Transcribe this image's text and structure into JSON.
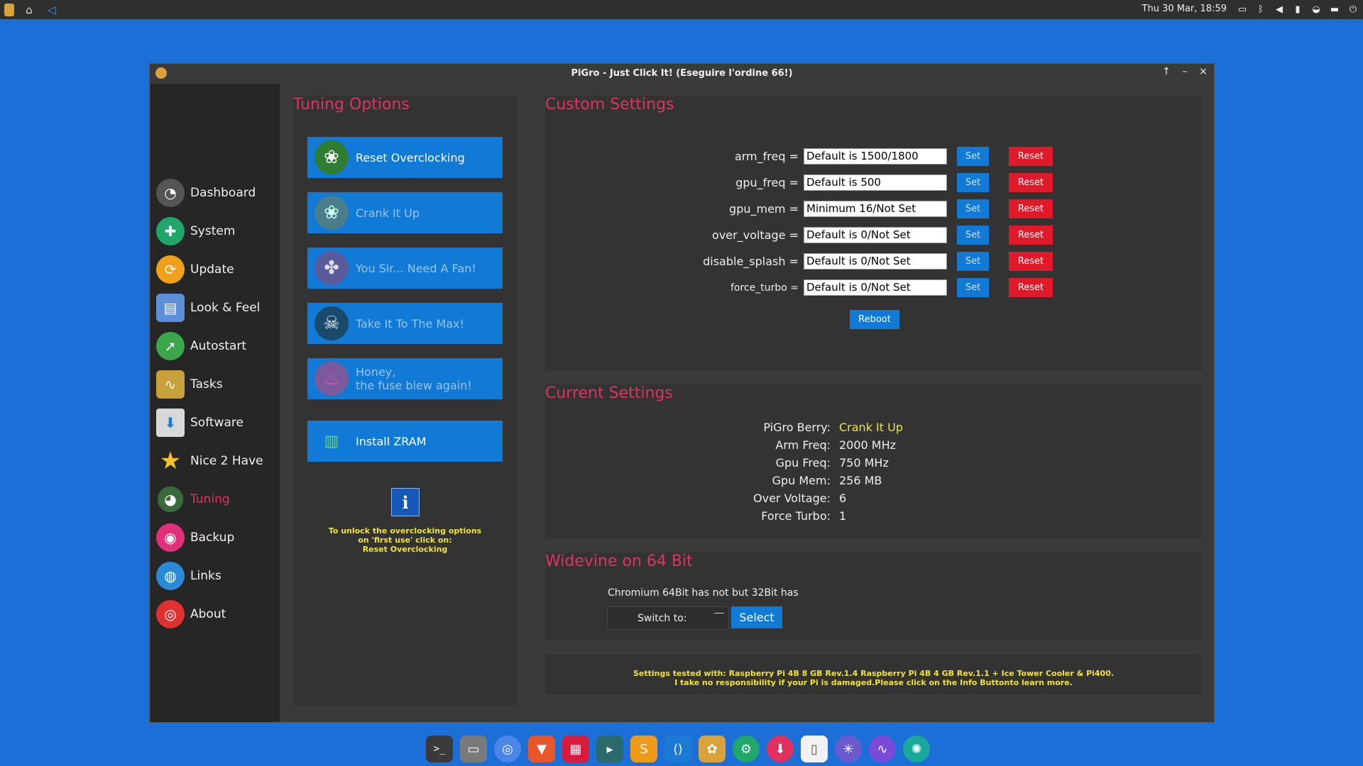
{
  "top_panel": {
    "clock": "Thu 30 Mar, 18:59",
    "left_icons": [
      "app-menu-icon",
      "home-icon",
      "vscode-icon"
    ],
    "tray_icons": [
      "display-icon",
      "bluetooth-icon",
      "volume-icon",
      "battery-icon",
      "notification-icon",
      "trash-icon",
      "power-icon"
    ]
  },
  "window": {
    "title": "PiGro - Just Click It! (Eseguire l'ordine 66!)",
    "controls": [
      "↑",
      "–",
      "×"
    ]
  },
  "sidebar": {
    "items": [
      {
        "label": "Dashboard",
        "icon": "dashboard-gauge-icon",
        "color": "#555555"
      },
      {
        "label": "System",
        "icon": "system-wrench-icon",
        "color": "#1fa86a"
      },
      {
        "label": "Update",
        "icon": "update-icon",
        "color": "#f0a01a"
      },
      {
        "label": "Look & Feel",
        "icon": "palette-icon",
        "color": "#5b8fd9"
      },
      {
        "label": "Autostart",
        "icon": "rocket-icon",
        "color": "#3aa84a"
      },
      {
        "label": "Tasks",
        "icon": "tasks-chart-icon",
        "color": "#c9a13a"
      },
      {
        "label": "Software",
        "icon": "software-box-icon",
        "color": "#d8d8d8"
      },
      {
        "label": "Nice 2 Have",
        "icon": "star-icon",
        "color": "#f6c12a"
      },
      {
        "label": "Tuning",
        "icon": "tuning-gauge-icon",
        "color": "#3b6b3b"
      },
      {
        "label": "Backup",
        "icon": "backup-icon",
        "color": "#e0307a"
      },
      {
        "label": "Links",
        "icon": "globe-icon",
        "color": "#2a8ad8"
      },
      {
        "label": "About",
        "icon": "lifebuoy-icon",
        "color": "#e03030"
      }
    ],
    "active": "Tuning"
  },
  "tuning": {
    "title": "Tuning Options",
    "buttons": [
      {
        "label": "Reset Overclocking",
        "icon": "raspberry-turtle-icon"
      },
      {
        "label": "Crank It Up",
        "icon": "raspberry-turtle-icon"
      },
      {
        "label": "You Sir... Need A Fan!",
        "icon": "raspberry-fan-icon"
      },
      {
        "label": "Take It To The Max!",
        "icon": "skull-icon"
      },
      {
        "label_line1": "Honey,",
        "label_line2": "the fuse blew again!",
        "icon": "fire-icon"
      },
      {
        "label": "Install ZRAM",
        "icon": "ram-icon"
      }
    ],
    "info_icon": "i",
    "note_line1": "To unlock the overclocking options",
    "note_line2": "on 'first use' click on:",
    "note_line3": "Reset Overclocking"
  },
  "custom": {
    "title": "Custom Settings",
    "rows": [
      {
        "key": "arm_freq =",
        "value": "Default is 1500/1800",
        "set": "Set",
        "reset": "Reset"
      },
      {
        "key": "gpu_freq =",
        "value": "Default is 500",
        "set": "Set",
        "reset": "Reset"
      },
      {
        "key": "gpu_mem =",
        "value": "Minimum 16/Not Set",
        "set": "Set",
        "reset": "Reset"
      },
      {
        "key": "over_voltage =",
        "value": "Default is 0/Not Set",
        "set": "Set",
        "reset": "Reset"
      },
      {
        "key": "disable_splash =",
        "value": "Default is 0/Not Set",
        "set": "Set",
        "reset": "Reset"
      },
      {
        "key": "force_turbo =",
        "value": "Default is 0/Not Set",
        "set": "Set",
        "reset": "Reset"
      }
    ],
    "reboot": "Reboot"
  },
  "current": {
    "title": "Current Settings",
    "rows": [
      {
        "label": "PiGro Berry:",
        "value": "Crank It Up"
      },
      {
        "label": "Arm Freq:",
        "value": "2000 MHz"
      },
      {
        "label": "Gpu Freq:",
        "value": "750 MHz"
      },
      {
        "label": "Gpu Mem:",
        "value": "256 MB"
      },
      {
        "label": "Over Voltage:",
        "value": "6"
      },
      {
        "label": "Force Turbo:",
        "value": "1"
      }
    ]
  },
  "widevine": {
    "title": "Widevine on 64 Bit",
    "text": "Chromium 64Bit has not but 32Bit has",
    "switch_label": "Switch to:",
    "select": "Select"
  },
  "footer": {
    "line1": "Settings tested with: Raspberry Pi 4B 8 GB Rev.1.4 Raspberry Pi 4B 4 GB Rev.1.1 + Ice Tower Cooler & Pi400.",
    "line2": "I take no responsibility if your Pi is damaged.Please click on the Info Buttonto learn more."
  },
  "dock": [
    {
      "icon": "terminal-icon",
      "color": "#3a3a3a",
      "glyph": ">_"
    },
    {
      "icon": "file-manager-icon",
      "color": "#7a7a7a",
      "glyph": "▭"
    },
    {
      "icon": "chromium-icon",
      "color": "#4a86e8",
      "glyph": "◎"
    },
    {
      "icon": "brave-icon",
      "color": "#e8572a",
      "glyph": "▼"
    },
    {
      "icon": "app-grid-icon",
      "color": "#d81b3c",
      "glyph": "▦"
    },
    {
      "icon": "terminal-emulator-icon",
      "color": "#2a6a6a",
      "glyph": "▸"
    },
    {
      "icon": "sublime-text-icon",
      "color": "#f09a1a",
      "glyph": "S"
    },
    {
      "icon": "vscode-icon",
      "color": "#1a7ad4",
      "glyph": "⟨⟩"
    },
    {
      "icon": "pigro-icon",
      "color": "#d9a23b",
      "glyph": "✿"
    },
    {
      "icon": "wrench-icon",
      "color": "#1fa86a",
      "glyph": "⚙"
    },
    {
      "icon": "download-icon",
      "color": "#e03060",
      "glyph": "⬇"
    },
    {
      "icon": "text-editor-icon",
      "color": "#f2f2f2",
      "glyph": "▯"
    },
    {
      "icon": "network-icon",
      "color": "#6a5acd",
      "glyph": "✳"
    },
    {
      "icon": "wave-app-icon",
      "color": "#7a4ad8",
      "glyph": "∿"
    },
    {
      "icon": "aperture-icon",
      "color": "#1aa89a",
      "glyph": "✺"
    }
  ]
}
